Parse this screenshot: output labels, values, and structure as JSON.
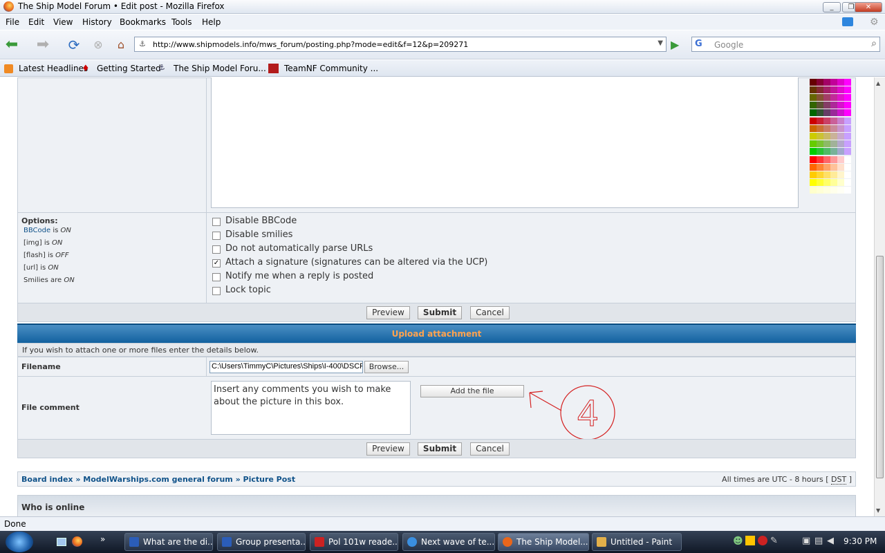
{
  "window": {
    "title": "The Ship Model Forum • Edit post - Mozilla Firefox"
  },
  "menu": [
    "File",
    "Edit",
    "View",
    "History",
    "Bookmarks",
    "Tools",
    "Help"
  ],
  "nav": {
    "url": "http://www.shipmodels.info/mws_forum/posting.php?mode=edit&f=12&p=209271",
    "search_placeholder": "Google"
  },
  "bookmarks": [
    "Latest Headlines",
    "Getting Started",
    "The Ship Model Foru...",
    "TeamNF Community ..."
  ],
  "options": {
    "title": "Options:",
    "status": [
      {
        "label": "BBCode",
        "is": " is ",
        "value": "ON"
      },
      {
        "label": "[img]",
        "is": " is ",
        "value": "ON"
      },
      {
        "label": "[flash]",
        "is": " is ",
        "value": "OFF"
      },
      {
        "label": "[url]",
        "is": " is ",
        "value": "ON"
      },
      {
        "label": "Smilies",
        "is": " are ",
        "value": "ON"
      }
    ],
    "checkboxes": [
      {
        "label": "Disable BBCode",
        "checked": false
      },
      {
        "label": "Disable smilies",
        "checked": false
      },
      {
        "label": "Do not automatically parse URLs",
        "checked": false
      },
      {
        "label": "Attach a signature (signatures can be altered via the UCP)",
        "checked": true
      },
      {
        "label": "Notify me when a reply is posted",
        "checked": false
      },
      {
        "label": "Lock topic",
        "checked": false
      }
    ]
  },
  "buttons": {
    "preview": "Preview",
    "submit": "Submit",
    "cancel": "Cancel",
    "browse": "Browse...",
    "add_file": "Add the file"
  },
  "upload": {
    "header": "Upload attachment",
    "hint": "If you wish to attach one or more files enter the details below.",
    "filename_label": "Filename",
    "filename_value": "C:\\Users\\TimmyC\\Pictures\\Ships\\I-400\\DSCF",
    "comment_label": "File comment",
    "comment_value": "Insert any comments you wish to make about the picture in this box."
  },
  "annotation": {
    "number": "4",
    "color": "#d42020"
  },
  "breadcrumb": {
    "items": [
      "Board index",
      "ModelWarships.com general forum",
      "Picture Post"
    ],
    "sep": " » ",
    "timezone": "All times are UTC - 8 hours [ ",
    "dst": "DST",
    " end": " ]"
  },
  "who_online": "Who is online",
  "status": "Done",
  "taskbar": {
    "tasks": [
      "What are the di...",
      "Group presenta...",
      "Pol 101w reade...",
      "Next wave of te...",
      "The Ship Model...",
      "Untitled - Paint"
    ],
    "clock": "9:30 PM"
  },
  "colors": {
    "link": "#105289",
    "header": "#12619f",
    "header_text": "#ffa34f"
  }
}
